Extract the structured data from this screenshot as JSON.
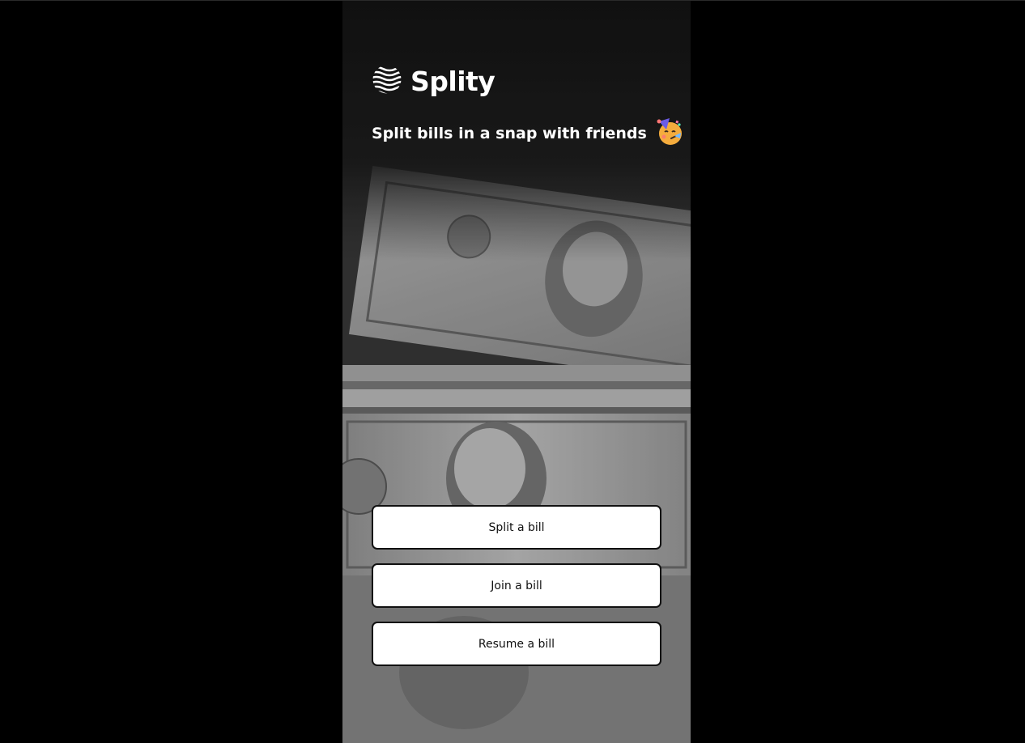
{
  "app": {
    "name": "Splity",
    "tagline": "Split bills in a snap with friends",
    "logo_icon": "wave-lines-icon",
    "tagline_icon": "party-face-emoji-icon"
  },
  "background": {
    "description_icon": "dollar-bills-photo",
    "page_color": "#000000"
  },
  "actions": {
    "split_label": "Split a bill",
    "join_label": "Join a bill",
    "resume_label": "Resume a bill"
  },
  "colors": {
    "button_bg": "#ffffff",
    "button_border": "#111111",
    "text_light": "#ffffff"
  }
}
